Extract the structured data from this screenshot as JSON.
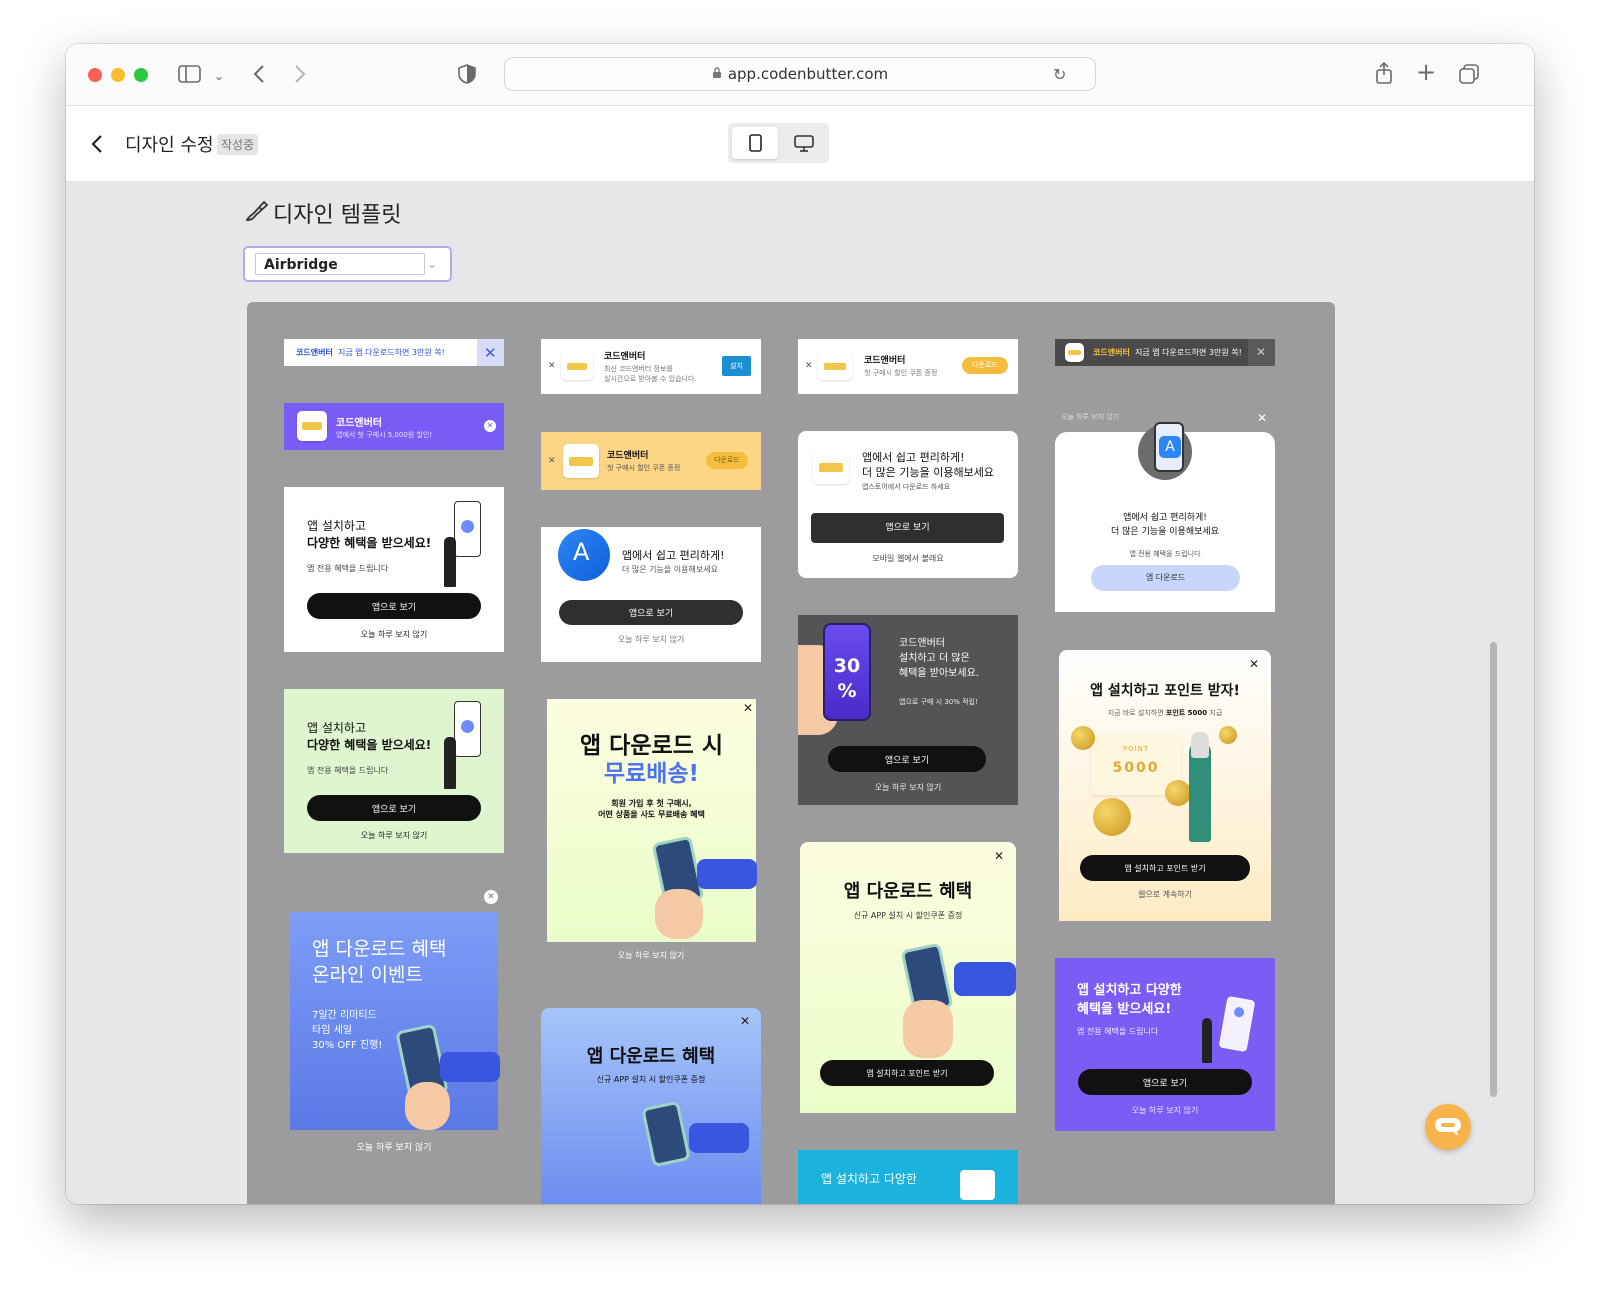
{
  "browser": {
    "url": "app.codenbutter.com"
  },
  "header": {
    "title": "디자인 수정",
    "badge": "작성중"
  },
  "section": {
    "title": "디자인 템플릿",
    "dropdown_value": "Airbridge"
  },
  "templates": {
    "t1": {
      "brand": "코드앤버터",
      "text": "지금 앱 다운로드하면 3만원 쏙!"
    },
    "t2": {
      "title": "코드앤버터",
      "sub": "앱에서 첫 구매시 5,000원 할인!"
    },
    "t3": {
      "line1": "앱 설치하고",
      "line2": "다양한 혜택을 받으세요!",
      "sub": "앱 전용 혜택을 드립니다",
      "btn": "앱으로 보기",
      "link": "오늘 하루 보지 않기"
    },
    "t4": {
      "line1": "앱 설치하고",
      "line2": "다양한 혜택을 받으세요!",
      "sub": "앱 전용 혜택을 드립니다",
      "btn": "앱으로 보기",
      "link": "오늘 하루 보지 않기"
    },
    "t5": {
      "line1": "앱 다운로드 혜택",
      "line2": "온라인 이벤트",
      "p1": "7일간 리미티드",
      "p2": "타임 세일",
      "p3": "30% OFF 진행!",
      "link": "오늘 하루 보지 않기"
    },
    "t6": {
      "title": "코드앤버터",
      "s1": "최신 코드앤버터 정보를",
      "s2": "실시간으로 받아볼 수 있습니다.",
      "btn": "설치"
    },
    "t7": {
      "title": "코드앤버터",
      "sub": "첫 구매시 할인 쿠폰 증정",
      "btn": "다운로드"
    },
    "t8": {
      "line1": "앱에서 쉽고 편리하게!",
      "sub": "더 많은 기능을 이용해보세요",
      "btn": "앱으로 보기",
      "link": "오늘 하루 보지 않기"
    },
    "t9": {
      "line1": "앱 다운로드 시",
      "line2": "무료배송!",
      "s1": "회원 가입 후 첫 구매시,",
      "s2": "어떤 상품을 사도 무료배송 혜택",
      "link": "오늘 하루 보지 않기"
    },
    "t10": {
      "title": "앱 다운로드 혜택",
      "sub": "신규 APP 설치 시 할인쿠폰 증정"
    },
    "t11": {
      "title": "코드앤버터",
      "sub": "첫 구매시 할인 쿠폰 증정",
      "btn": "다운로드"
    },
    "t12": {
      "line1": "앱에서 쉽고 편리하게!",
      "line2": "더 많은 기능을 이용해보세요",
      "sub": "앱스토어에서 다운로드 하세요",
      "btn": "앱으로 보기",
      "link": "모바일 웹에서 볼래요"
    },
    "t13": {
      "badge1": "30",
      "badge2": "%",
      "l1": "코드앤버터",
      "l2": "설치하고 더 많은",
      "l3": "혜택을 받아보세요.",
      "sub": "앱으로 구매 시 30% 적립!",
      "btn": "앱으로 보기",
      "link": "오늘 하루 보지 않기"
    },
    "t14": {
      "title": "앱 다운로드 혜택",
      "sub": "신규 APP 설치 시 할인쿠폰 증정",
      "btn": "앱 설치하고 포인트 받기"
    },
    "t15": {
      "title": "앱 설치하고 다양한"
    },
    "t16": {
      "brand": "코드앤버터",
      "text": "지금 앱 다운로드하면 3만원 쏙!"
    },
    "t17": {
      "top": "오늘 하루 보지 않기",
      "line1": "앱에서 쉽고 편리하게!",
      "line2": "더 많은 기능을 이용해보세요",
      "sub": "앱 전용 혜택을 드립니다",
      "btn": "앱 다운로드"
    },
    "t18": {
      "title": "앱 설치하고 포인트 받자!",
      "sub_a": "지금 바로 설치하면 ",
      "sub_b": "포인트 5000",
      "sub_c": " 지급",
      "point_label": "POINT",
      "point_value": "5000",
      "btn": "앱 설치하고 포인트 받기",
      "link": "웹으로 계속하기"
    },
    "t19": {
      "line1": "앱 설치하고 다양한",
      "line2": "혜택을 받으세요!",
      "sub": "앱 전용 혜택을 드립니다",
      "btn": "앱으로 보기",
      "link": "오늘 하루 보지 않기"
    }
  },
  "colors": {
    "purple": "#7b5cf5",
    "yellow": "#fbd98a",
    "dark": "#545456",
    "blue_grad": "#6b8cf0",
    "accent_btn": "#1a8fd1"
  }
}
